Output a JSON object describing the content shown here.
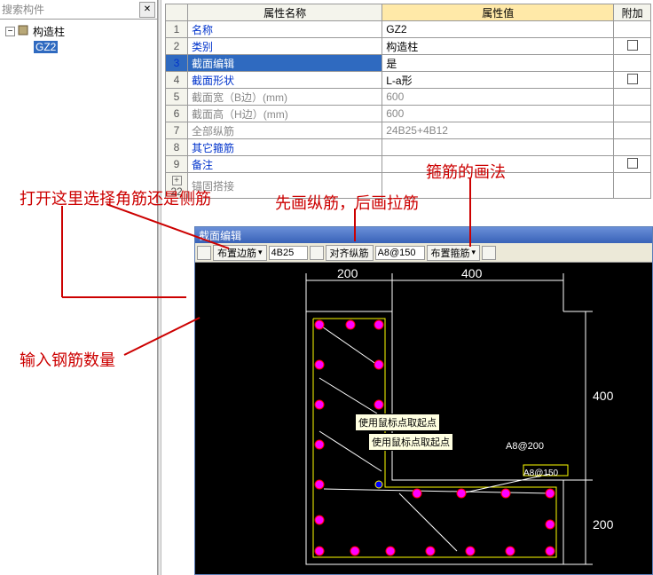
{
  "search_placeholder": "搜索构件",
  "tree": {
    "root": "构造柱",
    "child": "GZ2"
  },
  "table": {
    "headers": {
      "name": "属性名称",
      "value": "属性值",
      "extra": "附加"
    },
    "rows": [
      {
        "n": "1",
        "name": "名称",
        "value": "GZ2",
        "blue": true,
        "chk": false
      },
      {
        "n": "2",
        "name": "类别",
        "value": "构造柱",
        "blue": true,
        "chk": true
      },
      {
        "n": "3",
        "name": "截面编辑",
        "value": "是",
        "blue": true,
        "sel": true,
        "chk": false
      },
      {
        "n": "4",
        "name": "截面形状",
        "value": "L-a形",
        "blue": true,
        "chk": true
      },
      {
        "n": "5",
        "name": "截面宽（B边）(mm)",
        "value": "600",
        "gray": true,
        "chk": false
      },
      {
        "n": "6",
        "name": "截面高（H边）(mm)",
        "value": "600",
        "gray": true,
        "chk": false
      },
      {
        "n": "7",
        "name": "全部纵筋",
        "value": "24B25+4B12",
        "gray": true,
        "chk": false
      },
      {
        "n": "8",
        "name": "其它箍筋",
        "value": "",
        "blue": true,
        "chk": false
      },
      {
        "n": "9",
        "name": "备注",
        "value": "",
        "blue": true,
        "chk": true
      },
      {
        "n": "22",
        "name": "锚固搭接",
        "value": "",
        "gray": true,
        "plus": true,
        "chk": false
      }
    ]
  },
  "annotations": {
    "a1": "打开这里选择角筋还是侧筋",
    "a2": "先画纵筋，后画拉筋",
    "a3": "箍筋的画法",
    "a4": "输入钢筋数量"
  },
  "cad": {
    "title": "截面编辑",
    "toolbar": {
      "btn1": "布置边筋",
      "input1": "4B25",
      "btn2": "对齐纵筋",
      "input2": "A8@150",
      "btn3": "布置箍筋"
    },
    "dims": {
      "d200": "200",
      "d400a": "400",
      "d400b": "400",
      "d200b": "200"
    },
    "tooltip1": "使用鼠标点取起点",
    "tooltip2": "使用鼠标点取起点",
    "label1": "A8@200",
    "label2": "A8@150"
  }
}
